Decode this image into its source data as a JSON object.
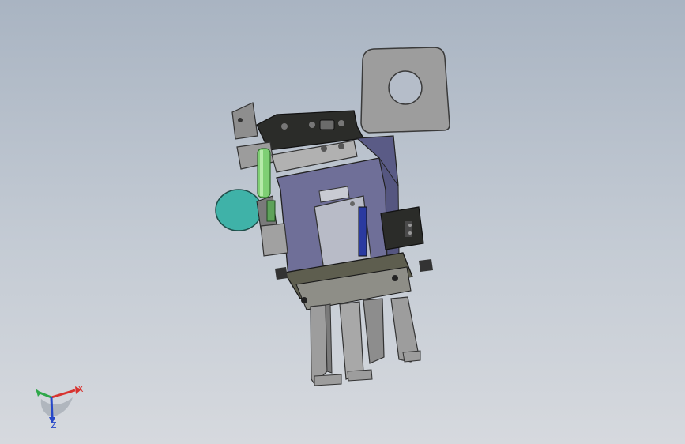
{
  "viewport": {
    "background_top": "#a9b4c2",
    "background_bottom": "#d6d9de"
  },
  "triad": {
    "x_label": "X",
    "z_label": "Z",
    "x_color": "#d8332f",
    "y_color": "#2fa84a",
    "z_color": "#2748c8"
  },
  "model": {
    "plate_color": "#9a9a9a",
    "body_color": "#6f6f98",
    "dark_color": "#2a2b28",
    "green_rod_color": "#7fcf74",
    "teal_disc_color": "#3fb2a8",
    "cover_color": "#b6b9c5",
    "connector_color": "#2a3aa0"
  }
}
